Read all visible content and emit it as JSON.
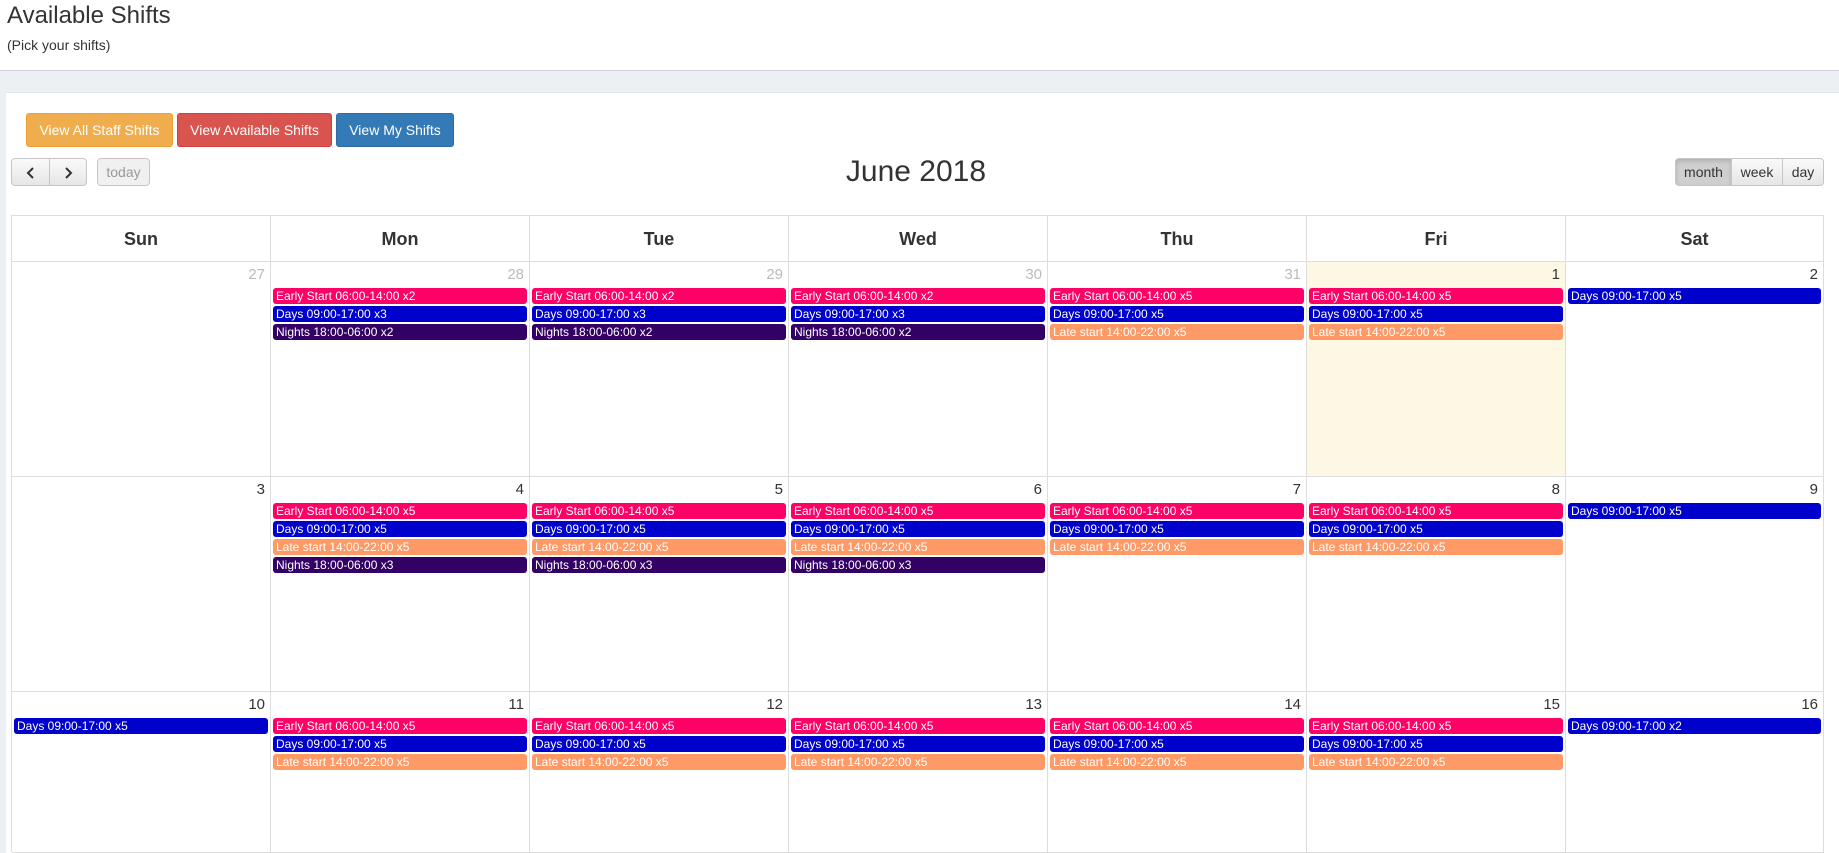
{
  "header": {
    "title": "Available Shifts",
    "subtitle": "(Pick your shifts)"
  },
  "actions": {
    "all_staff": "View All Staff Shifts",
    "available": "View Available Shifts",
    "mine": "View My Shifts"
  },
  "toolbar": {
    "today_label": "today",
    "title": "June 2018",
    "views": [
      "month",
      "week",
      "day"
    ],
    "active_view": "month"
  },
  "colors": {
    "early": "#ff0066",
    "days": "#0000cc",
    "late": "#ff9966",
    "nights": "#330066",
    "today_bg": "#fcf8e3"
  },
  "calendar": {
    "weekdays": [
      "Sun",
      "Mon",
      "Tue",
      "Wed",
      "Thu",
      "Fri",
      "Sat"
    ],
    "weeks": [
      [
        {
          "num": "27",
          "other": true,
          "events": []
        },
        {
          "num": "28",
          "other": true,
          "events": [
            {
              "type": "early",
              "label": "Early Start 06:00-14:00 x2"
            },
            {
              "type": "days",
              "label": "Days 09:00-17:00 x3"
            },
            {
              "type": "nights",
              "label": "Nights 18:00-06:00 x2"
            }
          ]
        },
        {
          "num": "29",
          "other": true,
          "events": [
            {
              "type": "early",
              "label": "Early Start 06:00-14:00 x2"
            },
            {
              "type": "days",
              "label": "Days 09:00-17:00 x3"
            },
            {
              "type": "nights",
              "label": "Nights 18:00-06:00 x2"
            }
          ]
        },
        {
          "num": "30",
          "other": true,
          "events": [
            {
              "type": "early",
              "label": "Early Start 06:00-14:00 x2"
            },
            {
              "type": "days",
              "label": "Days 09:00-17:00 x3"
            },
            {
              "type": "nights",
              "label": "Nights 18:00-06:00 x2"
            }
          ]
        },
        {
          "num": "31",
          "other": true,
          "events": [
            {
              "type": "early",
              "label": "Early Start 06:00-14:00 x5"
            },
            {
              "type": "days",
              "label": "Days 09:00-17:00 x5"
            },
            {
              "type": "late",
              "label": "Late start 14:00-22:00 x5"
            }
          ]
        },
        {
          "num": "1",
          "today": true,
          "events": [
            {
              "type": "early",
              "label": "Early Start 06:00-14:00 x5"
            },
            {
              "type": "days",
              "label": "Days 09:00-17:00 x5"
            },
            {
              "type": "late",
              "label": "Late start 14:00-22:00 x5"
            }
          ]
        },
        {
          "num": "2",
          "events": [
            {
              "type": "days",
              "label": "Days 09:00-17:00 x5"
            }
          ]
        }
      ],
      [
        {
          "num": "3",
          "events": []
        },
        {
          "num": "4",
          "events": [
            {
              "type": "early",
              "label": "Early Start 06:00-14:00 x5"
            },
            {
              "type": "days",
              "label": "Days 09:00-17:00 x5"
            },
            {
              "type": "late",
              "label": "Late start 14:00-22:00 x5"
            },
            {
              "type": "nights",
              "label": "Nights 18:00-06:00 x3"
            }
          ]
        },
        {
          "num": "5",
          "events": [
            {
              "type": "early",
              "label": "Early Start 06:00-14:00 x5"
            },
            {
              "type": "days",
              "label": "Days 09:00-17:00 x5"
            },
            {
              "type": "late",
              "label": "Late start 14:00-22:00 x5"
            },
            {
              "type": "nights",
              "label": "Nights 18:00-06:00 x3"
            }
          ]
        },
        {
          "num": "6",
          "events": [
            {
              "type": "early",
              "label": "Early Start 06:00-14:00 x5"
            },
            {
              "type": "days",
              "label": "Days 09:00-17:00 x5"
            },
            {
              "type": "late",
              "label": "Late start 14:00-22:00 x5"
            },
            {
              "type": "nights",
              "label": "Nights 18:00-06:00 x3"
            }
          ]
        },
        {
          "num": "7",
          "events": [
            {
              "type": "early",
              "label": "Early Start 06:00-14:00 x5"
            },
            {
              "type": "days",
              "label": "Days 09:00-17:00 x5"
            },
            {
              "type": "late",
              "label": "Late start 14:00-22:00 x5"
            }
          ]
        },
        {
          "num": "8",
          "events": [
            {
              "type": "early",
              "label": "Early Start 06:00-14:00 x5"
            },
            {
              "type": "days",
              "label": "Days 09:00-17:00 x5"
            },
            {
              "type": "late",
              "label": "Late start 14:00-22:00 x5"
            }
          ]
        },
        {
          "num": "9",
          "events": [
            {
              "type": "days",
              "label": "Days 09:00-17:00 x5"
            }
          ]
        }
      ],
      [
        {
          "num": "10",
          "events": [
            {
              "type": "days",
              "label": "Days 09:00-17:00 x5"
            }
          ]
        },
        {
          "num": "11",
          "events": [
            {
              "type": "early",
              "label": "Early Start 06:00-14:00 x5"
            },
            {
              "type": "days",
              "label": "Days 09:00-17:00 x5"
            },
            {
              "type": "late",
              "label": "Late start 14:00-22:00 x5"
            }
          ]
        },
        {
          "num": "12",
          "events": [
            {
              "type": "early",
              "label": "Early Start 06:00-14:00 x5"
            },
            {
              "type": "days",
              "label": "Days 09:00-17:00 x5"
            },
            {
              "type": "late",
              "label": "Late start 14:00-22:00 x5"
            }
          ]
        },
        {
          "num": "13",
          "events": [
            {
              "type": "early",
              "label": "Early Start 06:00-14:00 x5"
            },
            {
              "type": "days",
              "label": "Days 09:00-17:00 x5"
            },
            {
              "type": "late",
              "label": "Late start 14:00-22:00 x5"
            }
          ]
        },
        {
          "num": "14",
          "events": [
            {
              "type": "early",
              "label": "Early Start 06:00-14:00 x5"
            },
            {
              "type": "days",
              "label": "Days 09:00-17:00 x5"
            },
            {
              "type": "late",
              "label": "Late start 14:00-22:00 x5"
            }
          ]
        },
        {
          "num": "15",
          "events": [
            {
              "type": "early",
              "label": "Early Start 06:00-14:00 x5"
            },
            {
              "type": "days",
              "label": "Days 09:00-17:00 x5"
            },
            {
              "type": "late",
              "label": "Late start 14:00-22:00 x5"
            }
          ]
        },
        {
          "num": "16",
          "events": [
            {
              "type": "days",
              "label": "Days 09:00-17:00 x2"
            }
          ]
        }
      ]
    ]
  }
}
